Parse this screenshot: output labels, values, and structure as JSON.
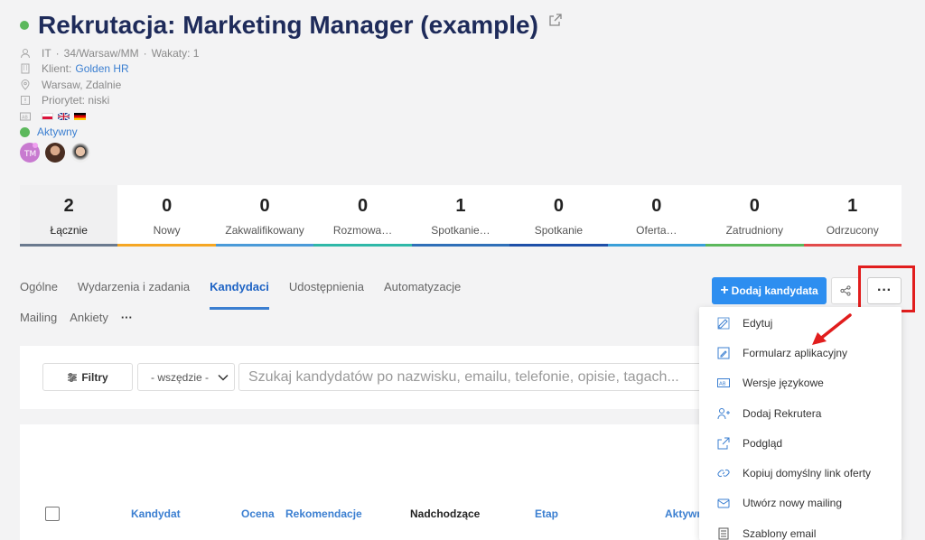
{
  "header": {
    "title": "Rekrutacja: Marketing Manager (example)",
    "status_color": "#5cb85c"
  },
  "meta": {
    "department": "IT",
    "code": "34/Warsaw/MM",
    "vacancies": "Wakaty: 1",
    "client_label": "Klient:",
    "client_name": "Golden HR",
    "location": "Warsaw, Zdalnie",
    "priority": "Priorytet: niski",
    "status": "Aktywny"
  },
  "stats": [
    {
      "value": "2",
      "label": "Łącznie",
      "color": "#6b7a8f"
    },
    {
      "value": "0",
      "label": "Nowy",
      "color": "#f5a623"
    },
    {
      "value": "0",
      "label": "Zakwalifikowany",
      "color": "#4a9ad8"
    },
    {
      "value": "0",
      "label": "Rozmowa…",
      "color": "#2fb8a8"
    },
    {
      "value": "1",
      "label": "Spotkanie…",
      "color": "#2f6fb8"
    },
    {
      "value": "0",
      "label": "Spotkanie",
      "color": "#1e4fa8"
    },
    {
      "value": "0",
      "label": "Oferta…",
      "color": "#3a9fd8"
    },
    {
      "value": "0",
      "label": "Zatrudniony",
      "color": "#5cb85c"
    },
    {
      "value": "1",
      "label": "Odrzucony",
      "color": "#e24b4b"
    }
  ],
  "tabs": {
    "row1": [
      "Ogólne",
      "Wydarzenia i zadania",
      "Kandydaci",
      "Udostępnienia",
      "Automatyzacje"
    ],
    "row2": [
      "Mailing",
      "Ankiety",
      "···"
    ],
    "active": "Kandydaci"
  },
  "actions": {
    "add_candidate": "Dodaj kandydata",
    "more": "···"
  },
  "filters": {
    "filter_label": "Filtry",
    "scope_value": "- wszędzie -",
    "search_placeholder": "Szukaj kandydatów po nazwisku, emailu, telefonie, opisie, tagach..."
  },
  "table": {
    "columns": [
      "Kandydat",
      "Ocena",
      "Rekomendacje",
      "Nadchodzące",
      "Etap",
      "Aktywn"
    ]
  },
  "menu": {
    "items": [
      {
        "label": "Edytuj",
        "icon": "edit-icon"
      },
      {
        "label": "Formularz aplikacyjny",
        "icon": "form-icon"
      },
      {
        "label": "Wersje językowe",
        "icon": "language-icon"
      },
      {
        "label": "Dodaj Rekrutera",
        "icon": "add-user-icon"
      },
      {
        "label": "Podgląd",
        "icon": "external-link-icon"
      },
      {
        "label": "Kopiuj domyślny link oferty",
        "icon": "link-icon"
      },
      {
        "label": "Utwórz nowy mailing",
        "icon": "mailing-icon"
      },
      {
        "label": "Szablony email",
        "icon": "template-icon"
      }
    ]
  },
  "colors": {
    "accent": "#2d8ef0",
    "title": "#1e2b5a",
    "highlight": "#e11d1d"
  }
}
